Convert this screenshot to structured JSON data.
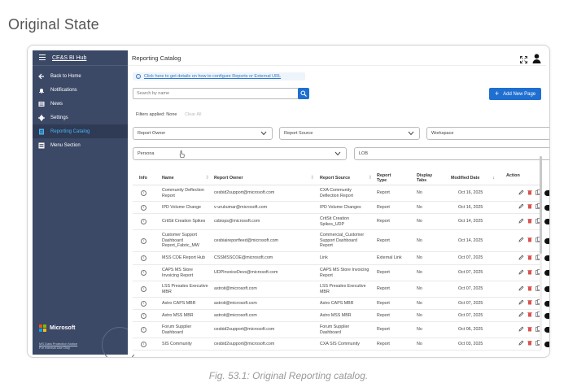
{
  "page_heading": "Original State",
  "caption": "Fig. 53.1: Original Reporting catalog.",
  "colors": {
    "sidebar_bg": "#3b4866",
    "active_text": "#47b7f5",
    "primary_button": "#1f6fd1",
    "link": "#2f79c8"
  },
  "sidebar": {
    "title": "CE&S BI Hub",
    "items": [
      {
        "label": "Back to Home",
        "icon": "arrow-left-icon"
      },
      {
        "label": "Notifications",
        "icon": "bell-icon"
      },
      {
        "label": "News",
        "icon": "news-icon"
      },
      {
        "label": "Settings",
        "icon": "gear-icon"
      },
      {
        "label": "Reporting Catalog",
        "icon": "document-icon",
        "active": true
      },
      {
        "label": "Menu Section",
        "icon": "menu-icon"
      }
    ],
    "brand": "Microsoft",
    "note_line1": "MS Data Protection Notice",
    "note_line2": "For Internal Use Only"
  },
  "topbar": {
    "title": "Reporting Catalog",
    "icons": [
      "expand-icon",
      "user-icon"
    ]
  },
  "info_banner": "Click here to get details on how to configure Reports or External URL",
  "search": {
    "placeholder": "Search by name"
  },
  "add_button": "Add New Page",
  "filters": {
    "applied_label": "Filters applied: None",
    "clear_label": "Clear All",
    "dropdowns": {
      "report_owner": "Report Owner",
      "report_source": "Report Source",
      "workspace": "Workspace",
      "persona": "Persona",
      "lob": "LOB"
    }
  },
  "table": {
    "headers": {
      "info": "Info",
      "name": "Name",
      "owner": "Report Owner",
      "source": "Report Source",
      "type": "Report Type",
      "tabs": "Display Tabs",
      "modified": "Modified Date",
      "action": "Action"
    },
    "rows": [
      {
        "name": "Community Deflection Report",
        "owner": "cesbid2support@microsoft.com",
        "source": "CXA Community Deflection Report",
        "type": "Report",
        "tabs": "No",
        "modified": "Oct 16, 2025"
      },
      {
        "name": "IPD Volume Change",
        "owner": "v-urukumar@microsoft.com",
        "source": "IPD Volume Changes",
        "type": "Report",
        "tabs": "No",
        "modified": "Oct 16, 2025"
      },
      {
        "name": "CritSit Creation Spikes",
        "owner": "csbiops@microsoft.com",
        "source": "CritSit Creation Spikes_UDP",
        "type": "Report",
        "tabs": "No",
        "modified": "Oct 14, 2025"
      },
      {
        "name": "Customer Support Dashboard Report_Fabric_MW",
        "owner": "cesbiaireportfeed@microsoft.com",
        "source": "Commercial_Customer Support Dashboard Report",
        "type": "Report",
        "tabs": "No",
        "modified": "Oct 14, 2025"
      },
      {
        "name": "MSS COE Report Hub",
        "owner": "CSSMSSCOE@microsoft.com",
        "source": "Link",
        "type": "External Link",
        "tabs": "No",
        "modified": "Oct 07, 2025"
      },
      {
        "name": "CAPS MS Store Invoicing Report",
        "owner": "UDPInvoiceDevs@microsoft.com",
        "source": "CAPS MS Store Invoicing Report",
        "type": "Report",
        "tabs": "No",
        "modified": "Oct 07, 2025"
      },
      {
        "name": "LSS Presales Executive MBR",
        "owner": "astroit@microsoft.com",
        "source": "LSS Presales Executive MBR",
        "type": "Report",
        "tabs": "No",
        "modified": "Oct 07, 2025"
      },
      {
        "name": "Astro CAPS MBR",
        "owner": "astroit@microsoft.com",
        "source": "Astro CAPS MBR",
        "type": "Report",
        "tabs": "No",
        "modified": "Oct 07, 2025"
      },
      {
        "name": "Astro MSS MBR",
        "owner": "astroit@microsoft.com",
        "source": "Astro MSS MBR",
        "type": "Report",
        "tabs": "No",
        "modified": "Oct 07, 2025"
      },
      {
        "name": "Forum Supplier Dashboard",
        "owner": "cesbid2support@microsoft.com",
        "source": "Forum Supplier Dashboard",
        "type": "Report",
        "tabs": "No",
        "modified": "Oct 06, 2025"
      },
      {
        "name": "SIS Community",
        "owner": "cesbid2support@microsoft.com",
        "source": "CXA SIS Community",
        "type": "Report",
        "tabs": "No",
        "modified": "Oct 03, 2025"
      }
    ]
  }
}
